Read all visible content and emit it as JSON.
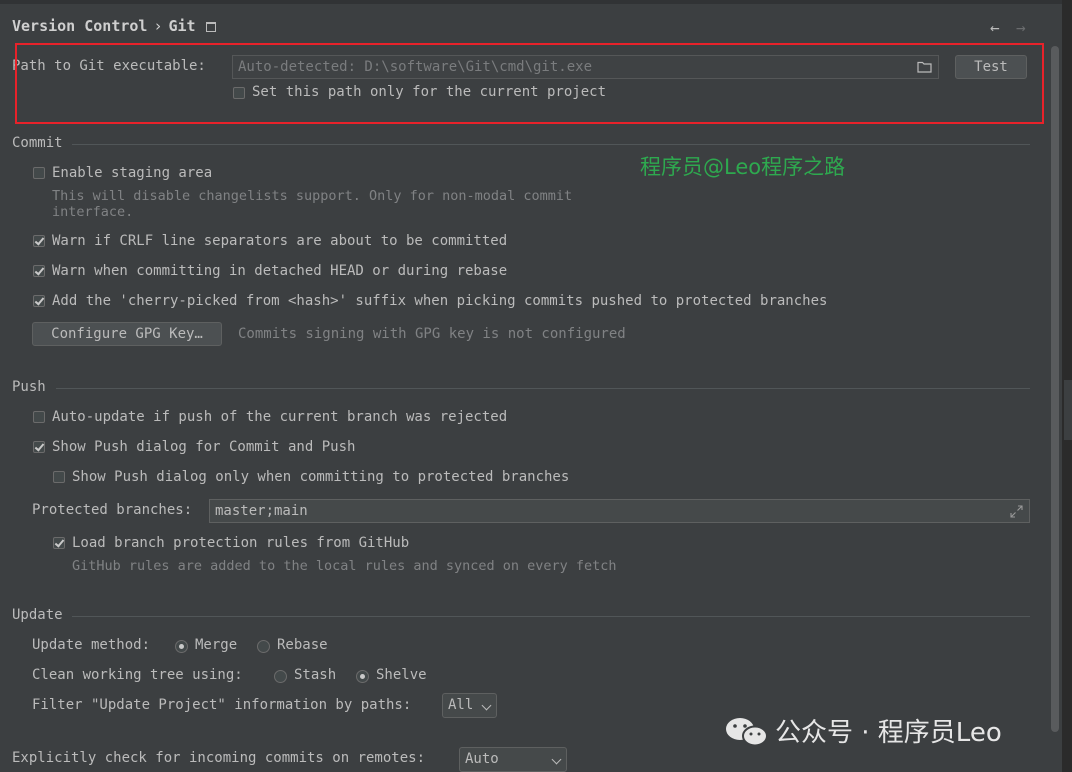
{
  "header": {
    "section": "Version Control",
    "separator": "›",
    "page": "Git",
    "back_icon": "←",
    "forward_icon": "→"
  },
  "git_path": {
    "label": "Path to Git executable:",
    "placeholder": "Auto-detected: D:\\software\\Git\\cmd\\git.exe",
    "test_button": "Test",
    "current_project_only": "Set this path only for the current project",
    "current_project_only_checked": false
  },
  "watermark": "程序员@Leo程序之路",
  "commit": {
    "title": "Commit",
    "enable_staging": "Enable staging area",
    "enable_staging_checked": false,
    "staging_hint_1": "This will disable changelists support. Only for non-modal commit",
    "staging_hint_2": "interface.",
    "warn_crlf": "Warn if CRLF line separators are about to be committed",
    "warn_crlf_checked": true,
    "warn_detached": "Warn when committing in detached HEAD or during rebase",
    "warn_detached_checked": true,
    "cherry_pick": "Add the 'cherry-picked from <hash>' suffix when picking commits pushed to protected branches",
    "cherry_pick_checked": true,
    "gpg_button": "Configure GPG Key…",
    "gpg_status": "Commits signing with GPG key is not configured"
  },
  "push": {
    "title": "Push",
    "auto_update": "Auto-update if push of the current branch was rejected",
    "auto_update_checked": false,
    "show_dialog": "Show Push dialog for Commit and Push",
    "show_dialog_checked": true,
    "show_dialog_protected": "Show Push dialog only when committing to protected branches",
    "show_dialog_protected_checked": false,
    "protected_label": "Protected branches:",
    "protected_value": "master;main",
    "load_rules": "Load branch protection rules from GitHub",
    "load_rules_checked": true,
    "rules_hint": "GitHub rules are added to the local rules and synced on every fetch"
  },
  "update": {
    "title": "Update",
    "method_label": "Update method:",
    "method_merge": "Merge",
    "method_rebase": "Rebase",
    "method_selected": "Merge",
    "clean_label": "Clean working tree using:",
    "clean_stash": "Stash",
    "clean_shelve": "Shelve",
    "clean_selected": "Shelve",
    "filter_label": "Filter \"Update Project\" information by paths:",
    "filter_value": "All"
  },
  "incoming": {
    "label": "Explicitly check for incoming commits on remotes:",
    "value": "Auto"
  },
  "wechat_tag": "公众号 · 程序员Leo"
}
